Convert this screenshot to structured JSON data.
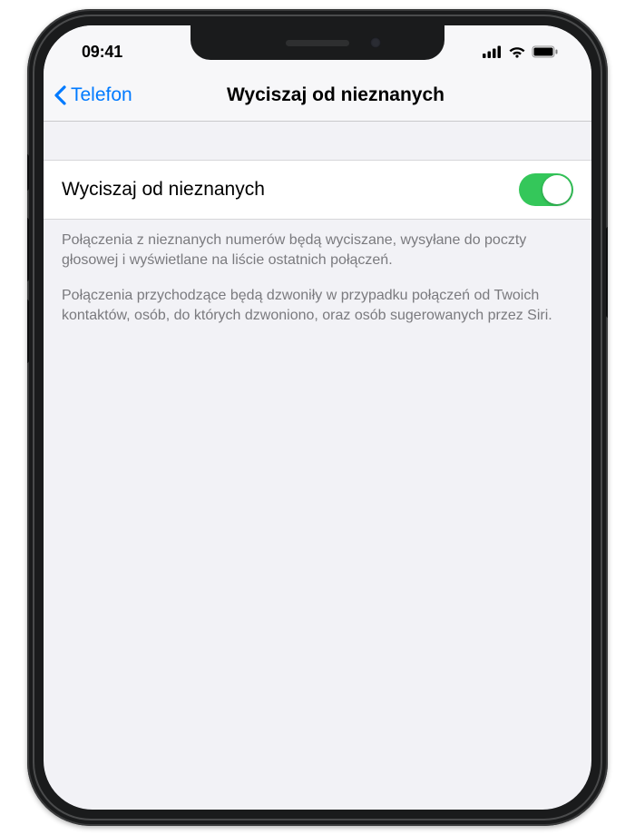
{
  "status": {
    "time": "09:41"
  },
  "nav": {
    "back_label": "Telefon",
    "title": "Wyciszaj od nieznanych"
  },
  "setting": {
    "label": "Wyciszaj od nieznanych",
    "enabled": true
  },
  "footer": {
    "paragraph1": "Połączenia z nieznanych numerów będą wyciszane, wysyłane do poczty głosowej i wyświetlane na liście ostatnich połączeń.",
    "paragraph2": "Połączenia przychodzące będą dzwoniły w przypadku połączeń od Twoich kontaktów, osób, do których dzwoniono, oraz osób sugerowanych przez Siri."
  },
  "colors": {
    "accent": "#007aff",
    "toggle_on": "#34c75a"
  }
}
